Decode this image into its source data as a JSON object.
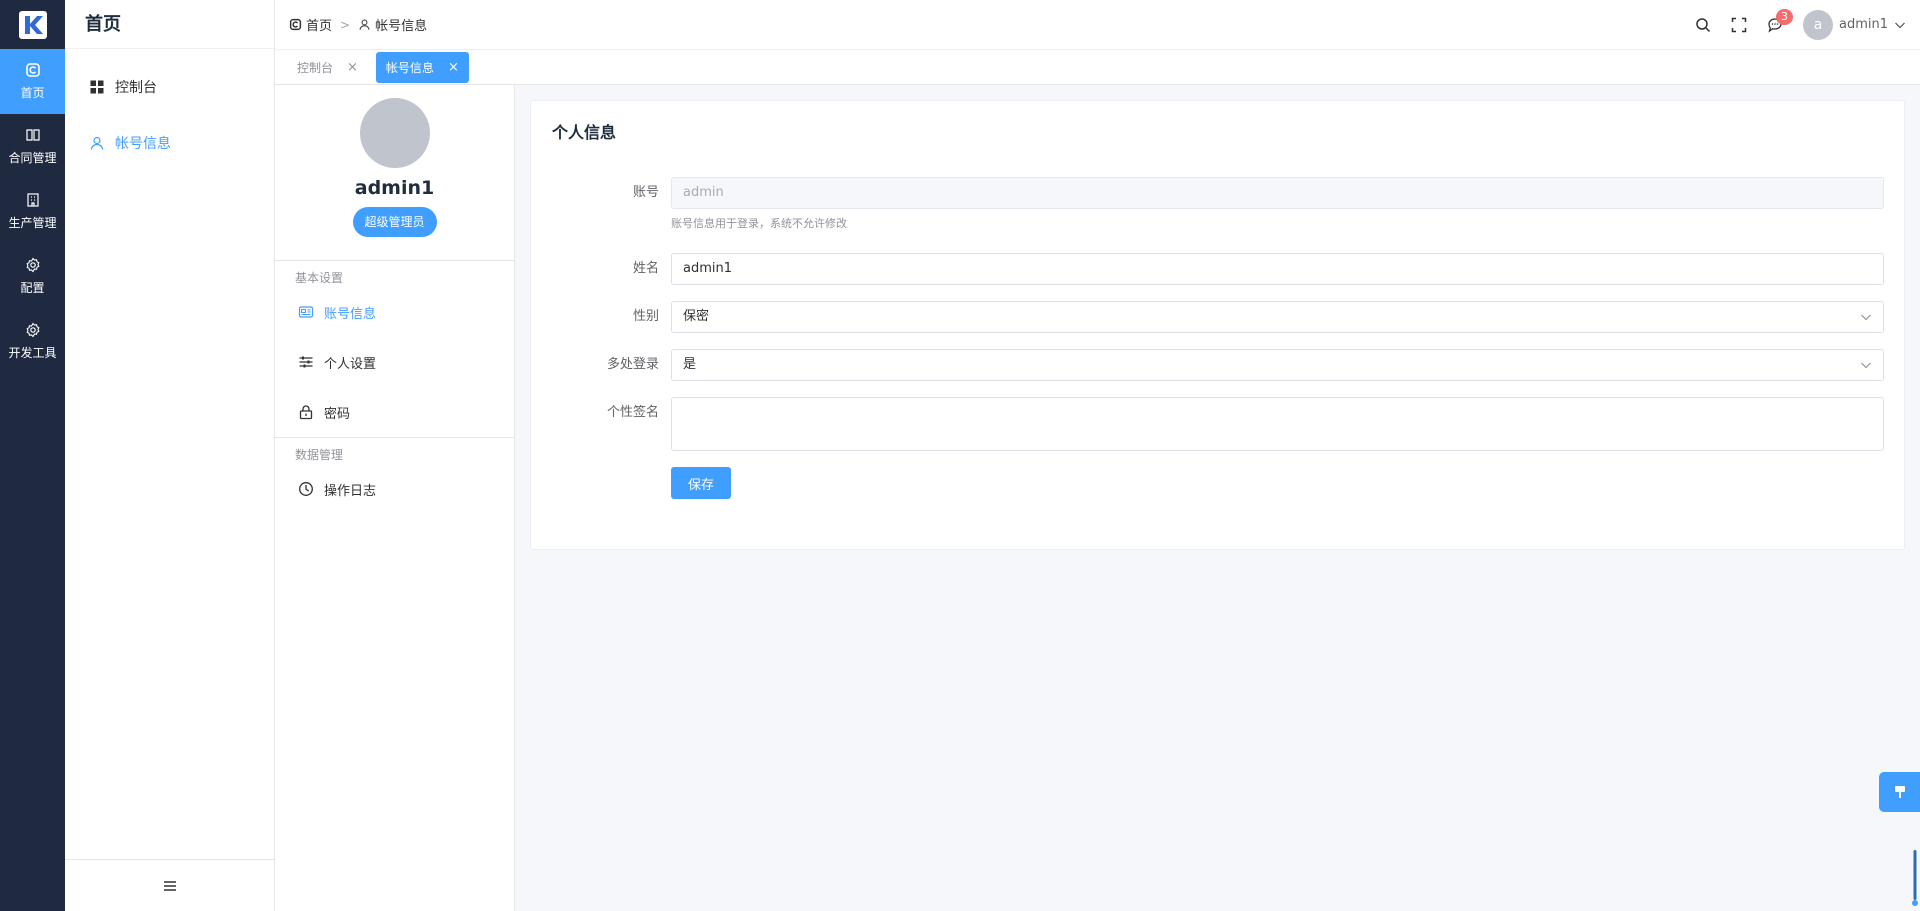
{
  "rail": {
    "items": [
      {
        "label": "首页",
        "icon": "home-icon"
      },
      {
        "label": "合同管理",
        "icon": "book-icon"
      },
      {
        "label": "生产管理",
        "icon": "building-icon"
      },
      {
        "label": "配置",
        "icon": "gear-icon"
      },
      {
        "label": "开发工具",
        "icon": "gear-icon"
      }
    ]
  },
  "submenu": {
    "title": "首页",
    "items": [
      {
        "label": "控制台",
        "icon": "dashboard-icon"
      },
      {
        "label": "帐号信息",
        "icon": "user-icon"
      }
    ]
  },
  "header": {
    "breadcrumb": [
      {
        "label": "首页",
        "icon": "home-icon"
      },
      {
        "label": "帐号信息",
        "icon": "user-icon"
      }
    ],
    "message_count": "3",
    "avatar_letter": "a",
    "user_name": "admin1"
  },
  "tabs": [
    {
      "label": "控制台",
      "close": "×"
    },
    {
      "label": "帐号信息",
      "close": "×"
    }
  ],
  "profile": {
    "name": "admin1",
    "role": "超级管理员",
    "sections": [
      {
        "title": "基本设置",
        "items": [
          {
            "label": "账号信息",
            "icon": "id-card-icon"
          },
          {
            "label": "个人设置",
            "icon": "sliders-icon"
          },
          {
            "label": "密码",
            "icon": "lock-icon"
          }
        ]
      },
      {
        "title": "数据管理",
        "items": [
          {
            "label": "操作日志",
            "icon": "clock-icon"
          }
        ]
      }
    ]
  },
  "form": {
    "card_title": "个人信息",
    "account": {
      "label": "账号",
      "value": "admin",
      "hint": "账号信息用于登录，系统不允许修改"
    },
    "name": {
      "label": "姓名",
      "value": "admin1"
    },
    "gender": {
      "label": "性别",
      "value": "保密"
    },
    "multi_login": {
      "label": "多处登录",
      "value": "是"
    },
    "signature": {
      "label": "个性签名",
      "value": ""
    },
    "save_label": "保存"
  },
  "colors": {
    "primary": "#409eff",
    "rail_bg": "#1f2a40",
    "badge": "#f56c6c"
  }
}
